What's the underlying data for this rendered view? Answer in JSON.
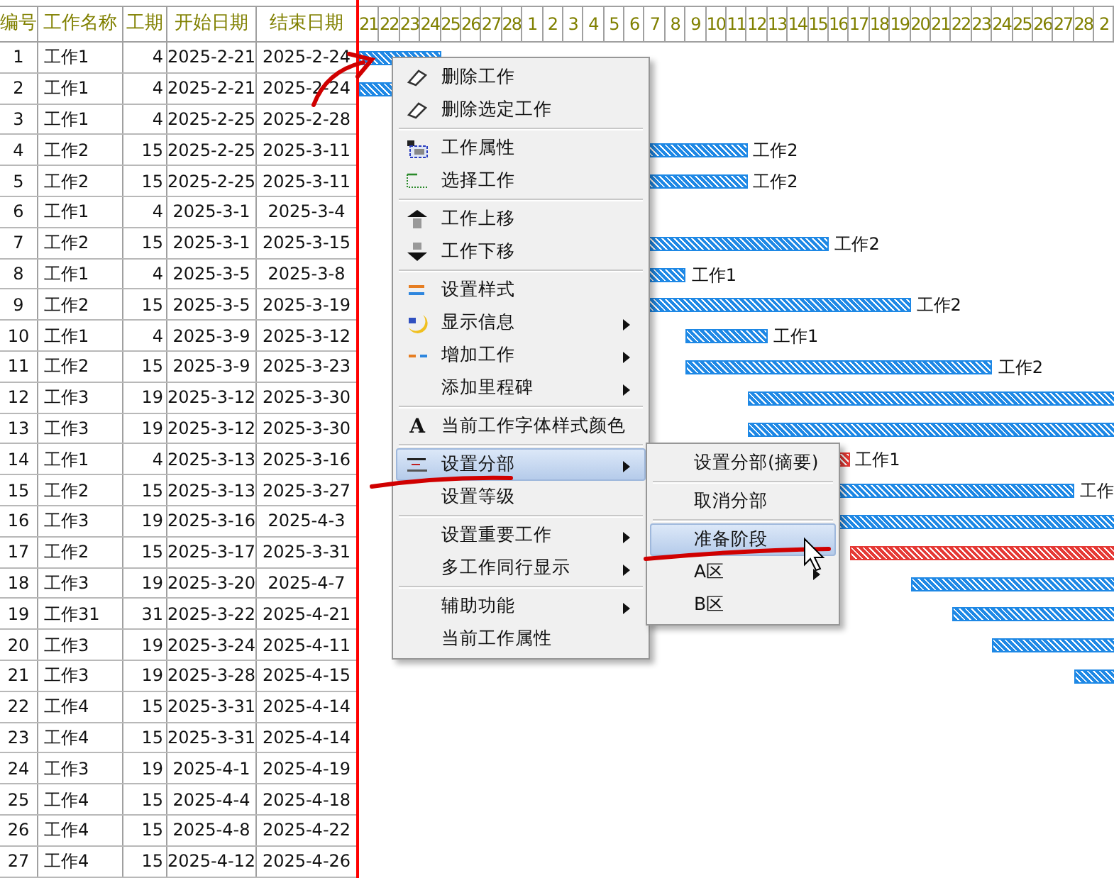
{
  "table": {
    "columns": [
      "编号",
      "工作名称",
      "工期",
      "开始日期",
      "结束日期"
    ],
    "rows": [
      {
        "cells": [
          "1",
          "工作1",
          "4",
          "2025-2-21",
          "2025-2-24"
        ],
        "bar": {
          "color": "#1e88e5"
        }
      },
      {
        "cells": [
          "2",
          "工作1",
          "4",
          "2025-2-21",
          "2025-2-24"
        ],
        "bar": {
          "color": "#1e88e5"
        }
      },
      {
        "cells": [
          "3",
          "工作1",
          "4",
          "2025-2-25",
          "2025-2-28"
        ]
      },
      {
        "cells": [
          "4",
          "工作2",
          "15",
          "2025-2-25",
          "2025-3-11"
        ],
        "bar": {
          "color": "#1e88e5",
          "label": "工作2"
        }
      },
      {
        "cells": [
          "5",
          "工作2",
          "15",
          "2025-2-25",
          "2025-3-11"
        ],
        "bar": {
          "color": "#1e88e5",
          "label": "工作2"
        }
      },
      {
        "cells": [
          "6",
          "工作1",
          "4",
          "2025-3-1",
          "2025-3-4"
        ]
      },
      {
        "cells": [
          "7",
          "工作2",
          "15",
          "2025-3-1",
          "2025-3-15"
        ],
        "bar": {
          "color": "#1e88e5",
          "label": "工作2"
        }
      },
      {
        "cells": [
          "8",
          "工作1",
          "4",
          "2025-3-5",
          "2025-3-8"
        ],
        "bar": {
          "color": "#1e88e5",
          "label": "工作1"
        }
      },
      {
        "cells": [
          "9",
          "工作2",
          "15",
          "2025-3-5",
          "2025-3-19"
        ],
        "bar": {
          "color": "#1e88e5",
          "label": "工作2"
        }
      },
      {
        "cells": [
          "10",
          "工作1",
          "4",
          "2025-3-9",
          "2025-3-12"
        ],
        "bar": {
          "color": "#1e88e5",
          "label": "工作1"
        }
      },
      {
        "cells": [
          "11",
          "工作2",
          "15",
          "2025-3-9",
          "2025-3-23"
        ],
        "bar": {
          "color": "#1e88e5",
          "label": "工作2"
        }
      },
      {
        "cells": [
          "12",
          "工作3",
          "19",
          "2025-3-12",
          "2025-3-30"
        ],
        "bar": {
          "color": "#1e88e5"
        }
      },
      {
        "cells": [
          "13",
          "工作3",
          "19",
          "2025-3-12",
          "2025-3-30"
        ],
        "bar": {
          "color": "#1e88e5"
        }
      },
      {
        "cells": [
          "14",
          "工作1",
          "4",
          "2025-3-13",
          "2025-3-16"
        ],
        "bar": {
          "color": "#e53935",
          "label": "工作1"
        }
      },
      {
        "cells": [
          "15",
          "工作2",
          "15",
          "2025-3-13",
          "2025-3-27"
        ],
        "bar": {
          "color": "#1e88e5",
          "label": "工作"
        }
      },
      {
        "cells": [
          "16",
          "工作3",
          "19",
          "2025-3-16",
          "2025-4-3"
        ],
        "bar": {
          "color": "#1e88e5"
        }
      },
      {
        "cells": [
          "17",
          "工作2",
          "15",
          "2025-3-17",
          "2025-3-31"
        ],
        "bar": {
          "color": "#e53935"
        }
      },
      {
        "cells": [
          "18",
          "工作3",
          "19",
          "2025-3-20",
          "2025-4-7"
        ],
        "bar": {
          "color": "#1e88e5"
        }
      },
      {
        "cells": [
          "19",
          "工作31",
          "31",
          "2025-3-22",
          "2025-4-21"
        ],
        "bar": {
          "color": "#1e88e5"
        }
      },
      {
        "cells": [
          "20",
          "工作3",
          "19",
          "2025-3-24",
          "2025-4-11"
        ],
        "bar": {
          "color": "#1e88e5"
        }
      },
      {
        "cells": [
          "21",
          "工作3",
          "19",
          "2025-3-28",
          "2025-4-15"
        ],
        "bar": {
          "color": "#1e88e5"
        }
      },
      {
        "cells": [
          "22",
          "工作4",
          "15",
          "2025-3-31",
          "2025-4-14"
        ]
      },
      {
        "cells": [
          "23",
          "工作4",
          "15",
          "2025-3-31",
          "2025-4-14"
        ]
      },
      {
        "cells": [
          "24",
          "工作3",
          "19",
          "2025-4-1",
          "2025-4-19"
        ]
      },
      {
        "cells": [
          "25",
          "工作4",
          "15",
          "2025-4-4",
          "2025-4-18"
        ]
      },
      {
        "cells": [
          "26",
          "工作4",
          "15",
          "2025-4-8",
          "2025-4-22"
        ]
      },
      {
        "cells": [
          "27",
          "工作4",
          "15",
          "2025-4-12",
          "2025-4-26"
        ]
      }
    ]
  },
  "timeline": {
    "days": [
      "21",
      "22",
      "23",
      "24",
      "25",
      "26",
      "27",
      "28",
      "1",
      "2",
      "3",
      "4",
      "5",
      "6",
      "7",
      "8",
      "9",
      "10",
      "11",
      "12",
      "13",
      "14",
      "15",
      "16",
      "17",
      "18",
      "19",
      "20",
      "21",
      "22",
      "23",
      "24",
      "25",
      "26",
      "27",
      "28",
      "2"
    ]
  },
  "context_menu": {
    "items": [
      {
        "kind": "eraser",
        "label": "删除工作",
        "submenu": false,
        "selected": false
      },
      {
        "kind": "eraser",
        "label": "删除选定工作",
        "submenu": false,
        "selected": false
      },
      {
        "kind": "separator"
      },
      {
        "kind": "properties",
        "label": "工作属性",
        "submenu": false,
        "selected": false
      },
      {
        "kind": "select",
        "label": "选择工作",
        "submenu": false,
        "selected": false
      },
      {
        "kind": "separator"
      },
      {
        "kind": "up",
        "label": "工作上移",
        "submenu": false,
        "selected": false
      },
      {
        "kind": "down",
        "label": "工作下移",
        "submenu": false,
        "selected": false
      },
      {
        "kind": "separator"
      },
      {
        "kind": "style",
        "label": "设置样式",
        "submenu": false,
        "selected": false
      },
      {
        "kind": "info",
        "label": "显示信息",
        "submenu": true,
        "selected": false
      },
      {
        "kind": "add",
        "label": "增加工作",
        "submenu": true,
        "selected": false
      },
      {
        "kind": "plain",
        "label": "添加里程碑",
        "submenu": true,
        "selected": false
      },
      {
        "kind": "separator"
      },
      {
        "kind": "font",
        "icon": "A",
        "label": "当前工作字体样式颜色",
        "submenu": false,
        "selected": false
      },
      {
        "kind": "separator"
      },
      {
        "kind": "section",
        "label": "设置分部",
        "submenu": true,
        "selected": true
      },
      {
        "kind": "plain",
        "label": "设置等级",
        "submenu": false,
        "selected": false
      },
      {
        "kind": "separator"
      },
      {
        "kind": "plain",
        "label": "设置重要工作",
        "submenu": true,
        "selected": false
      },
      {
        "kind": "plain",
        "label": "多工作同行显示",
        "submenu": true,
        "selected": false
      },
      {
        "kind": "separator"
      },
      {
        "kind": "plain",
        "label": "辅助功能",
        "submenu": true,
        "selected": false
      },
      {
        "kind": "plain",
        "label": "当前工作属性",
        "submenu": false,
        "selected": false
      }
    ]
  },
  "submenu": {
    "items": [
      {
        "kind": "plain",
        "label": "设置分部(摘要)",
        "submenu": false,
        "selected": false
      },
      {
        "kind": "separator"
      },
      {
        "kind": "plain",
        "label": "取消分部",
        "submenu": false,
        "selected": false
      },
      {
        "kind": "separator"
      },
      {
        "kind": "plain",
        "label": "准备阶段",
        "submenu": false,
        "selected": true
      },
      {
        "kind": "plain",
        "label": "A区",
        "submenu": true,
        "selected": false
      },
      {
        "kind": "plain",
        "label": "B区",
        "submenu": false,
        "selected": false
      }
    ]
  }
}
